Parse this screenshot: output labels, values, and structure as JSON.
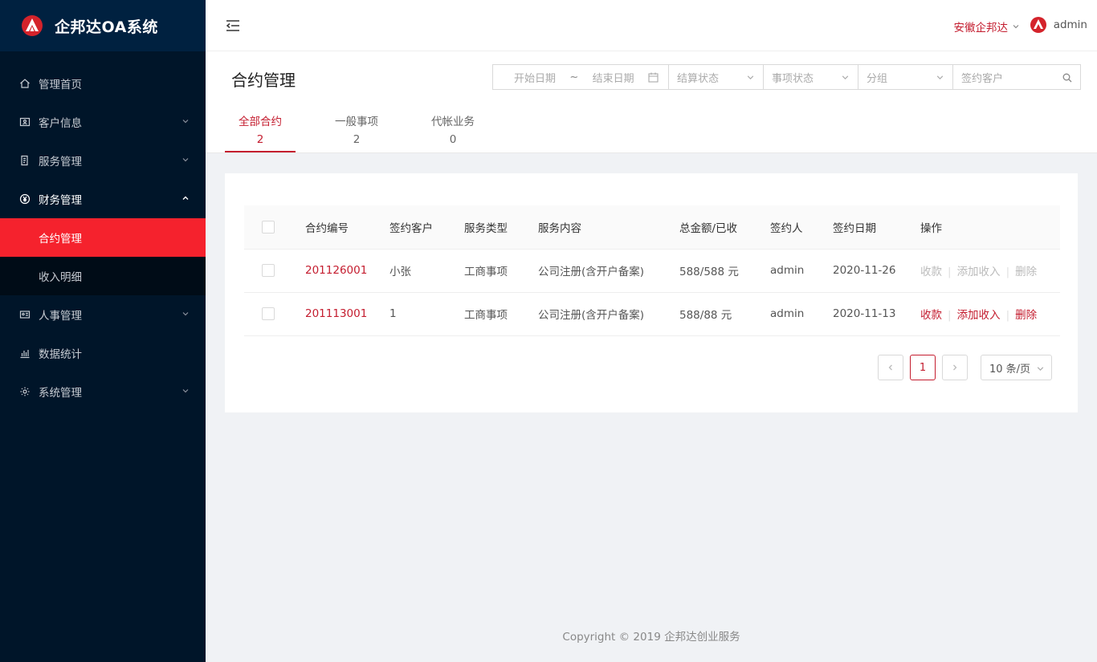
{
  "app": {
    "title": "企邦达OA系统"
  },
  "sidebar": {
    "items": [
      {
        "label": "管理首页",
        "icon": "home-icon"
      },
      {
        "label": "客户信息",
        "icon": "customer-icon"
      },
      {
        "label": "服务管理",
        "icon": "service-icon"
      },
      {
        "label": "财务管理",
        "icon": "yen-icon"
      },
      {
        "label": "人事管理",
        "icon": "id-card-icon"
      },
      {
        "label": "数据统计",
        "icon": "bar-chart-icon"
      },
      {
        "label": "系统管理",
        "icon": "gear-icon"
      }
    ],
    "finance_sub": [
      {
        "label": "合约管理"
      },
      {
        "label": "收入明细"
      }
    ]
  },
  "header": {
    "company": "安徽企邦达",
    "user": "admin"
  },
  "page": {
    "title": "合约管理",
    "filters": {
      "start_date": "开始日期",
      "date_sep": "~",
      "end_date": "结束日期",
      "settle_status": "结算状态",
      "item_status": "事项状态",
      "group": "分组",
      "customer": "签约客户"
    },
    "tabs": [
      {
        "label": "全部合约",
        "count": "2"
      },
      {
        "label": "一般事项",
        "count": "2"
      },
      {
        "label": "代帐业务",
        "count": "0"
      }
    ]
  },
  "table": {
    "headers": [
      "合约编号",
      "签约客户",
      "服务类型",
      "服务内容",
      "总金额/已收",
      "签约人",
      "签约日期",
      "操作"
    ],
    "rows": [
      {
        "no": "201126001",
        "customer": "小张",
        "type": "工商事项",
        "content": "公司注册(含开户备案)",
        "amount": "588/588 元",
        "signer": "admin",
        "date": "2020-11-26",
        "op1": "收款",
        "op2": "添加收入",
        "op3": "删除"
      },
      {
        "no": "201113001",
        "customer": "1",
        "type": "工商事项",
        "content": "公司注册(含开户备案)",
        "amount": "588/88 元",
        "signer": "admin",
        "date": "2020-11-13",
        "op1": "收款",
        "op2": "添加收入",
        "op3": "删除"
      }
    ],
    "op_sep": "|"
  },
  "pagination": {
    "current": "1",
    "page_size": "10 条/页"
  },
  "footer": {
    "copyright": "Copyright © 2019 企邦达创业服务"
  },
  "colors": {
    "accent": "#c41d2f",
    "sidebar_bg": "#001529",
    "active_menu": "#f5222d"
  }
}
